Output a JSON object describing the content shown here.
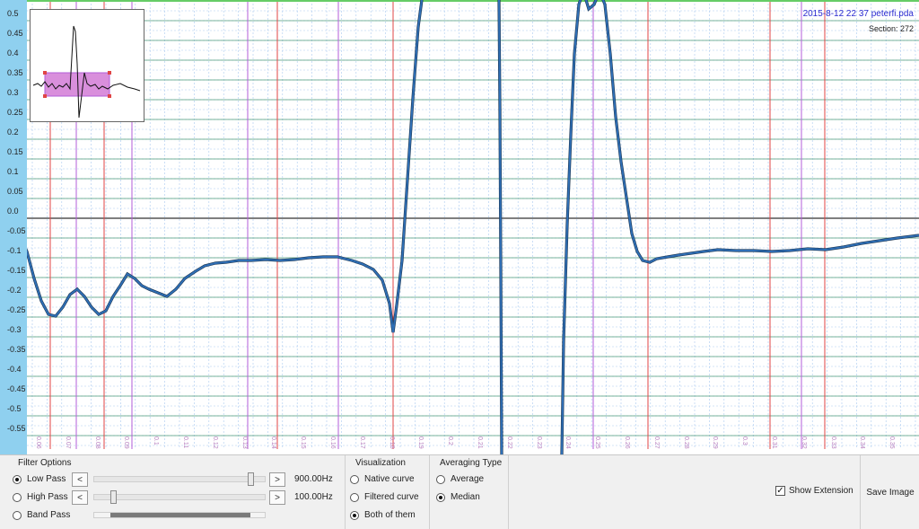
{
  "header": {
    "filename": "2015-8-12 22 37 peterfi.pda",
    "section": "Section: 272"
  },
  "axis": {
    "y_labels": [
      "0.5",
      "0.45",
      "0.4",
      "0.35",
      "0.3",
      "0.25",
      "0.2",
      "0.15",
      "0.1",
      "0.05",
      "0.0",
      "-0.05",
      "-0.1",
      "-0.15",
      "-0.2",
      "-0.25",
      "-0.3",
      "-0.35",
      "-0.4",
      "-0.45",
      "-0.5",
      "-0.55"
    ],
    "x_labels": [
      "0.06",
      "0.07",
      "0.08",
      "0.09",
      "0.1",
      "0.11",
      "0.12",
      "0.13",
      "0.14",
      "0.15",
      "0.16",
      "0.17",
      "0.18",
      "0.19",
      "0.2",
      "0.21",
      "0.22",
      "0.23",
      "0.24",
      "0.25",
      "0.26",
      "0.27",
      "0.28",
      "0.29",
      "0.3",
      "0.31",
      "0.32",
      "0.33",
      "0.34",
      "0.35"
    ]
  },
  "colors": {
    "curve": "#2f6fb6",
    "grid_major": "#4c9a7a",
    "grid_minor": "#a9c9ef",
    "red_marker": "#e04545",
    "purple_marker": "#b35ed8",
    "axis_strip": "#8fd0ef",
    "inset_box": "#d98fdc"
  },
  "filter_options": {
    "title": "Filter Options",
    "low_pass": {
      "label": "Low Pass",
      "selected": true,
      "value": "900.00Hz",
      "level": 0.93
    },
    "high_pass": {
      "label": "High Pass",
      "selected": false,
      "value": "100.00Hz",
      "level": 0.1
    },
    "band_pass": {
      "label": "Band Pass",
      "selected": false
    }
  },
  "visualization": {
    "title": "Visualization",
    "options": [
      {
        "label": "Native curve",
        "selected": false
      },
      {
        "label": "Filtered curve",
        "selected": false
      },
      {
        "label": "Both of them",
        "selected": true
      }
    ]
  },
  "averaging": {
    "title": "Averaging Type",
    "options": [
      {
        "label": "Average",
        "selected": false
      },
      {
        "label": "Median",
        "selected": true
      }
    ]
  },
  "show_extension": {
    "label": "Show Extension",
    "checked": true
  },
  "save_image": {
    "label": "Save Image"
  },
  "icons": {
    "scroll_left": "arrow-left-icon",
    "scroll_right": "arrow-right-icon",
    "check": "checkmark-icon"
  }
}
